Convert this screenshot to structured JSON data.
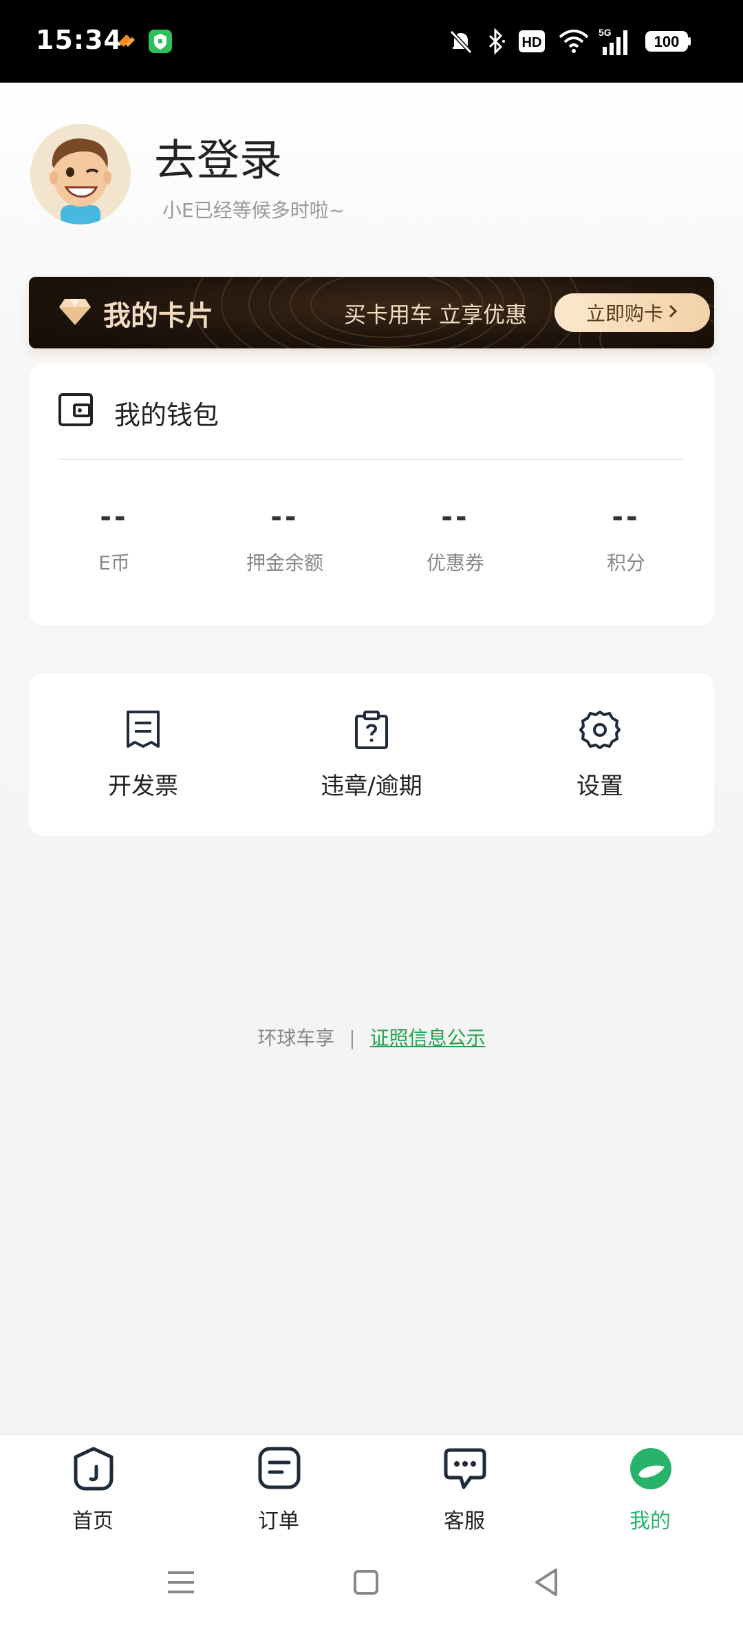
{
  "status_bar": {
    "time": "15:34",
    "icons": [
      "notification-off-icon",
      "bluetooth-icon",
      "hd-icon",
      "wifi-icon",
      "5g-signal-icon",
      "battery-icon"
    ],
    "hd": "HD",
    "network": "5G",
    "battery": "100"
  },
  "profile": {
    "title": "去登录",
    "subtitle": "小E已经等候多时啦~"
  },
  "card_banner": {
    "title": "我的卡片",
    "promo": "买卡用车 立享优惠",
    "button": "立即购卡"
  },
  "wallet": {
    "title": "我的钱包",
    "stats": [
      {
        "value": "--",
        "label": "E币"
      },
      {
        "value": "--",
        "label": "押金余额"
      },
      {
        "value": "--",
        "label": "优惠券"
      },
      {
        "value": "--",
        "label": "积分"
      }
    ]
  },
  "tools": [
    {
      "label": "开发票",
      "icon": "invoice-icon"
    },
    {
      "label": "违章/逾期",
      "icon": "violation-icon"
    },
    {
      "label": "设置",
      "icon": "gear-icon"
    }
  ],
  "footer": {
    "company": "环球车享",
    "separator": "|",
    "link": "证照信息公示"
  },
  "bottom_nav": [
    {
      "label": "首页",
      "icon": "home-icon",
      "active": false
    },
    {
      "label": "订单",
      "icon": "orders-icon",
      "active": false
    },
    {
      "label": "客服",
      "icon": "service-icon",
      "active": false
    },
    {
      "label": "我的",
      "icon": "profile-icon",
      "active": true
    }
  ],
  "colors": {
    "accent_green": "#27b46a",
    "link_green": "#1fa24a",
    "banner_dark": "#1f140c",
    "banner_gold": "#f1dcc0"
  }
}
